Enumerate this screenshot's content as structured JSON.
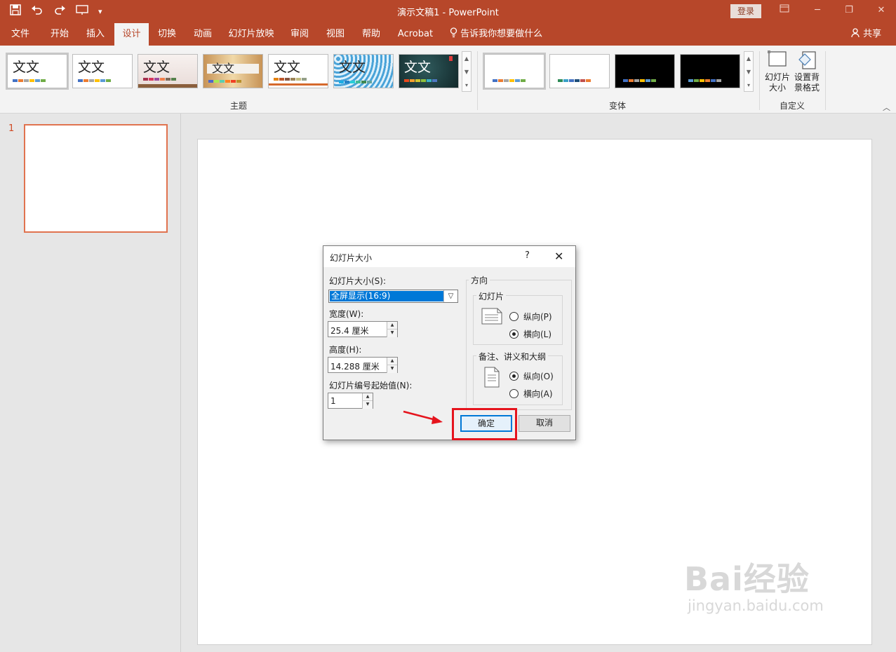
{
  "titlebar": {
    "title": "演示文稿1 - PowerPoint",
    "login_label": "登录",
    "qat_icons": [
      "save-icon",
      "undo-icon",
      "redo-icon",
      "present-icon",
      "customize-icon"
    ]
  },
  "tabs": [
    {
      "label": "文件"
    },
    {
      "label": "开始"
    },
    {
      "label": "插入"
    },
    {
      "label": "设计",
      "active": true
    },
    {
      "label": "切换"
    },
    {
      "label": "动画"
    },
    {
      "label": "幻灯片放映"
    },
    {
      "label": "审阅"
    },
    {
      "label": "视图"
    },
    {
      "label": "帮助"
    },
    {
      "label": "Acrobat"
    }
  ],
  "tell_me": "告诉我你想要做什么",
  "share": "共享",
  "ribbon": {
    "themes_label": "主题",
    "variants_label": "变体",
    "customize_label": "自定义",
    "theme_text": "文文",
    "slide_size_label": "幻灯片大小",
    "format_bg_label": "设置背景格式"
  },
  "thumbnail": {
    "number": "1"
  },
  "watermark": {
    "big": "Bai经验",
    "small": "jingyan.baidu.com"
  },
  "dialog": {
    "title": "幻灯片大小",
    "help": "?",
    "close": "✕",
    "size_label": "幻灯片大小(S):",
    "size_value": "全屏显示(16:9)",
    "width_label": "宽度(W):",
    "width_value": "25.4 厘米",
    "height_label": "高度(H):",
    "height_value": "14.288 厘米",
    "start_label": "幻灯片编号起始值(N):",
    "start_value": "1",
    "orientation_label": "方向",
    "slides_group": "幻灯片",
    "slides_portrait": "纵向(P)",
    "slides_landscape": "横向(L)",
    "notes_group": "备注、讲义和大纲",
    "notes_portrait": "纵向(O)",
    "notes_landscape": "横向(A)",
    "ok": "确定",
    "cancel": "取消"
  }
}
